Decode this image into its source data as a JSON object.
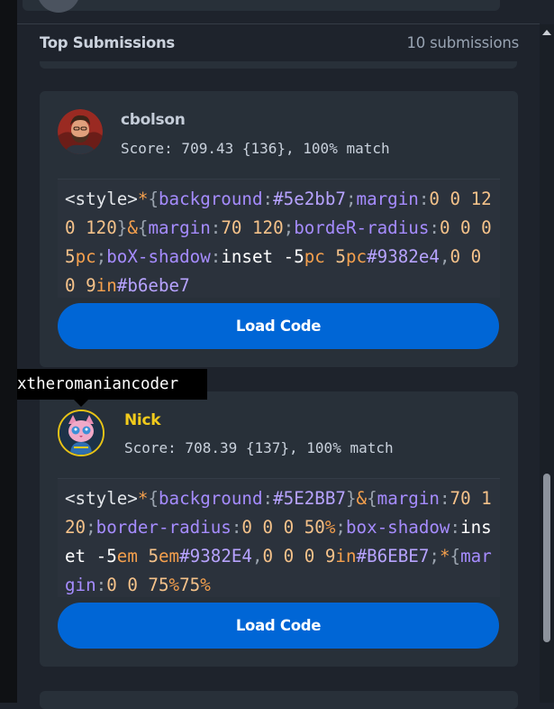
{
  "header": {
    "title": "Top Submissions",
    "count": "10 submissions"
  },
  "submissions": [
    {
      "username": "cbolson",
      "score": "Score: 709.43 {136}, 100% match",
      "avatar_icon": "user-photo-avatar",
      "load_label": "Load Code",
      "code_tokens": [
        [
          "tag",
          "<style>"
        ],
        [
          "sel",
          "*"
        ],
        [
          "punc",
          "{"
        ],
        [
          "prop",
          "background"
        ],
        [
          "punc",
          ":"
        ],
        [
          "hex",
          "#5e2bb7"
        ],
        [
          "punc",
          ";"
        ],
        [
          "prop",
          "margin"
        ],
        [
          "punc",
          ":"
        ],
        [
          "num",
          "0 0 120 120"
        ],
        [
          "punc",
          "}"
        ],
        [
          "sel",
          "&"
        ],
        [
          "punc",
          "{"
        ],
        [
          "prop",
          "margin"
        ],
        [
          "punc",
          ":"
        ],
        [
          "num",
          "70 120"
        ],
        [
          "punc",
          ";"
        ],
        [
          "prop",
          "bordeR-radius"
        ],
        [
          "punc",
          ":"
        ],
        [
          "num",
          "0 0 0 5"
        ],
        [
          "unit",
          "pc"
        ],
        [
          "punc",
          ";"
        ],
        [
          "prop",
          "boX-shadow"
        ],
        [
          "punc",
          ":"
        ],
        [
          "val",
          "inset -5"
        ],
        [
          "unit",
          "pc"
        ],
        [
          "val",
          " "
        ],
        [
          "num",
          "5"
        ],
        [
          "unit",
          "pc"
        ],
        [
          "hex",
          "#9382e4"
        ],
        [
          "punc",
          ","
        ],
        [
          "num",
          "0 0 0 9"
        ],
        [
          "unit",
          "in"
        ],
        [
          "hex",
          "#b6ebe7"
        ]
      ]
    },
    {
      "username": "Nick",
      "score": "Score: 708.39 {137}, 100% match",
      "avatar_icon": "cat-mascot-avatar",
      "load_label": "Load Code",
      "code_tokens": [
        [
          "tag",
          "<style>"
        ],
        [
          "sel",
          "*"
        ],
        [
          "punc",
          "{"
        ],
        [
          "prop",
          "background"
        ],
        [
          "punc",
          ":"
        ],
        [
          "hex",
          "#5E2BB7"
        ],
        [
          "punc",
          "}"
        ],
        [
          "sel",
          "&"
        ],
        [
          "punc",
          "{"
        ],
        [
          "prop",
          "margin"
        ],
        [
          "punc",
          ":"
        ],
        [
          "num",
          "70 120"
        ],
        [
          "punc",
          ";"
        ],
        [
          "prop",
          "border-radius"
        ],
        [
          "punc",
          ":"
        ],
        [
          "num",
          "0 0 0 50"
        ],
        [
          "unit",
          "%"
        ],
        [
          "punc",
          ";"
        ],
        [
          "prop",
          "box-shadow"
        ],
        [
          "punc",
          ":"
        ],
        [
          "val",
          "inset -5"
        ],
        [
          "unit",
          "em"
        ],
        [
          "val",
          " "
        ],
        [
          "num",
          "5"
        ],
        [
          "unit",
          "em"
        ],
        [
          "hex",
          "#9382E4"
        ],
        [
          "punc",
          ","
        ],
        [
          "num",
          "0 0 0 9"
        ],
        [
          "unit",
          "in"
        ],
        [
          "hex",
          "#B6EBE7"
        ],
        [
          "punc",
          ";"
        ],
        [
          "sel",
          "*"
        ],
        [
          "punc",
          "{"
        ],
        [
          "prop",
          "margin"
        ],
        [
          "punc",
          ":"
        ],
        [
          "num",
          "0 0 75"
        ],
        [
          "unit",
          "%"
        ],
        [
          "num",
          "75"
        ],
        [
          "unit",
          "%"
        ]
      ]
    }
  ],
  "tooltip": {
    "text": "xtheromaniancoder"
  },
  "colors": {
    "accent_button": "#0066d6",
    "gold_ring": "#e8c316",
    "panel": "#283039",
    "background": "#1e232c"
  }
}
